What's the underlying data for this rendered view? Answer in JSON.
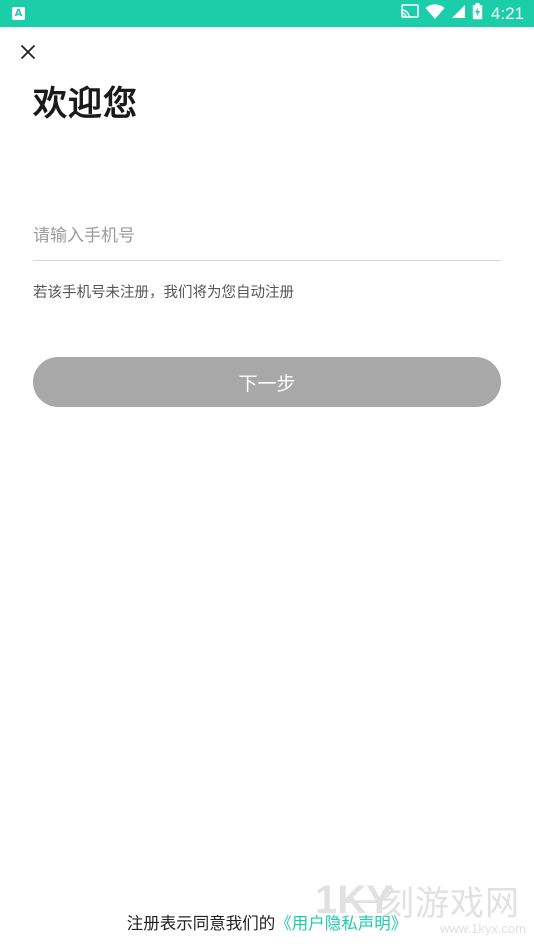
{
  "status_bar": {
    "time": "4:21",
    "app_badge": "A",
    "icons": [
      "cast-icon",
      "wifi-icon",
      "signal-icon",
      "battery-icon"
    ],
    "color": "#1bcda8"
  },
  "header": {
    "close_icon": "close-icon"
  },
  "login": {
    "title": "欢迎您",
    "phone_placeholder": "请输入手机号",
    "phone_value": "",
    "hint": "若该手机号未注册，我们将为您自动注册",
    "next_label": "下一步"
  },
  "agreement": {
    "prefix": "注册表示同意我们的",
    "link": "《用户隐私声明》",
    "link_color": "#1bcda8"
  },
  "watermark": {
    "logo": "1KY",
    "text": "一刻游戏网",
    "url": "www.1kyx.com"
  }
}
